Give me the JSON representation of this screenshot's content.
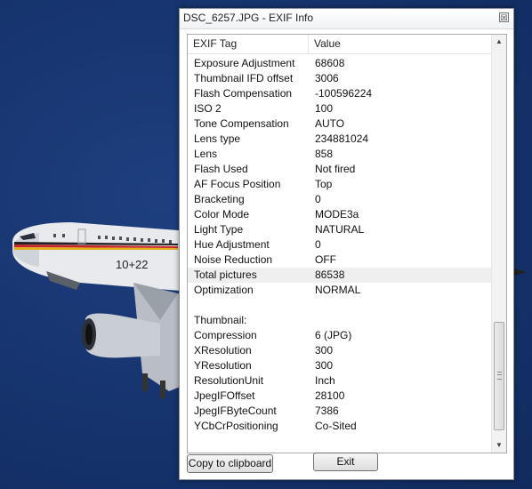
{
  "window": {
    "title": "DSC_6257.JPG - EXIF Info",
    "close_glyph": "☒"
  },
  "table": {
    "columns": [
      "EXIF Tag",
      "Value"
    ],
    "rows": [
      [
        "Exposure Adjustment",
        "68608"
      ],
      [
        "Thumbnail IFD offset",
        "3006"
      ],
      [
        "Flash Compensation",
        "-100596224"
      ],
      [
        "ISO 2",
        "100"
      ],
      [
        "Tone Compensation",
        "AUTO"
      ],
      [
        "Lens type",
        "234881024"
      ],
      [
        "Lens",
        "858"
      ],
      [
        "Flash Used",
        "Not fired"
      ],
      [
        "AF Focus Position",
        "Top"
      ],
      [
        "Bracketing",
        "0"
      ],
      [
        "Color Mode",
        "MODE3a"
      ],
      [
        "Light Type",
        "NATURAL"
      ],
      [
        "Hue Adjustment",
        "0"
      ],
      [
        "Noise Reduction",
        "OFF"
      ],
      [
        "Total pictures",
        "86538"
      ],
      [
        "Optimization",
        "NORMAL"
      ],
      [
        "",
        ""
      ],
      [
        "Thumbnail:",
        ""
      ],
      [
        "Compression",
        "6 (JPG)"
      ],
      [
        "XResolution",
        "300"
      ],
      [
        "YResolution",
        "300"
      ],
      [
        "ResolutionUnit",
        "Inch"
      ],
      [
        "JpegIFOffset",
        "28100"
      ],
      [
        "JpegIFByteCount",
        "7386"
      ],
      [
        "YCbCrPositioning",
        "Co-Sited"
      ]
    ],
    "selected_row_index": 14
  },
  "scrollbar": {
    "up_glyph": "▲",
    "down_glyph": "▼"
  },
  "buttons": {
    "copy_label": "Copy to clipboard",
    "exit_label": "Exit"
  },
  "background": {
    "aircraft_marking": "10+22"
  },
  "colors": {
    "sky": "#173570",
    "selection": "#efefef"
  }
}
